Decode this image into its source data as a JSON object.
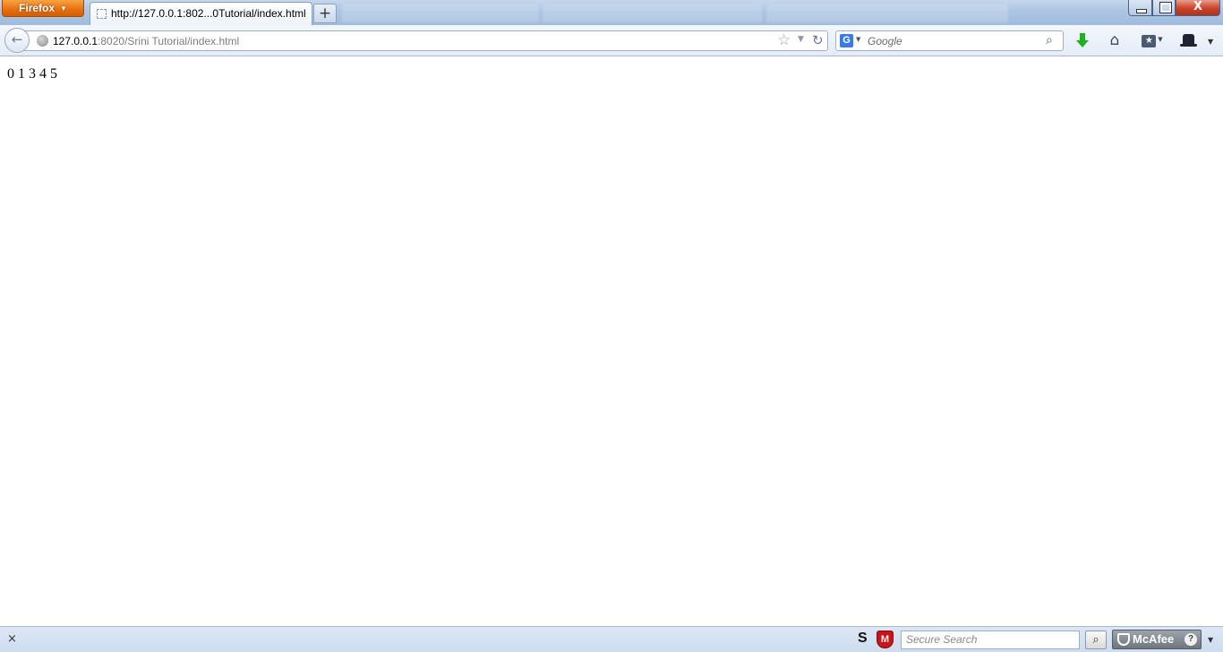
{
  "browser": {
    "app_button_label": "Firefox",
    "active_tab": {
      "title": "http://127.0.0.1:802...0Tutorial/index.html"
    },
    "new_tab_label": "+",
    "window_controls": {
      "close_label": "X"
    }
  },
  "navbar": {
    "url": {
      "host": "127.0.0.1",
      "rest": ":8020/Srini Tutorial/index.html"
    },
    "search": {
      "engine_icon": "G",
      "placeholder": "Google"
    }
  },
  "page": {
    "output_text": "0 1 3 4 5"
  },
  "statusbar": {
    "close_label": "×",
    "s_label": "S",
    "shield_label": "M",
    "secure_search_placeholder": "Secure Search",
    "mcafee_label": "McAfee",
    "help_label": "?"
  },
  "colors": {
    "firefox_orange": "#e66f0f",
    "chrome_blue": "#c6d7ec",
    "mcafee_red": "#c4161c",
    "download_green": "#1bb31b"
  },
  "icons": [
    "back-arrow-icon",
    "globe-icon",
    "star-icon",
    "reload-icon",
    "search-icon",
    "download-icon",
    "home-icon",
    "bookmarks-icon",
    "hat-icon",
    "shield-icon",
    "help-icon"
  ]
}
